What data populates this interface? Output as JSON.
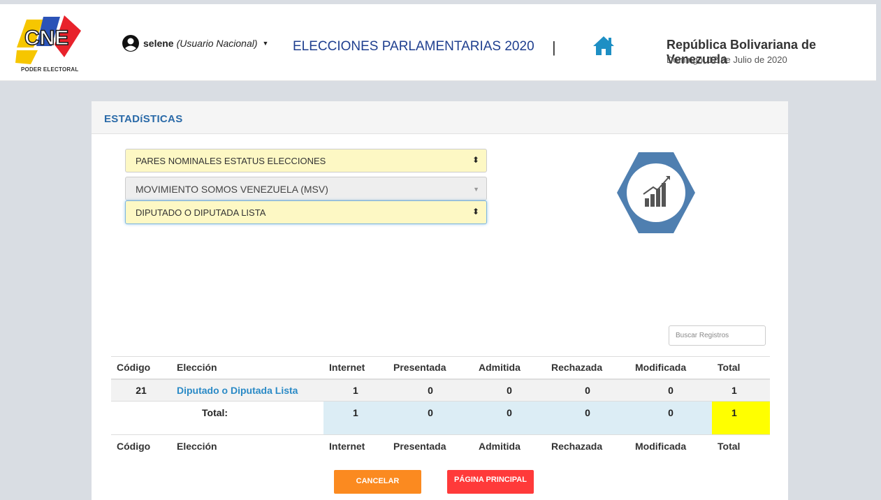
{
  "header": {
    "logo_caption": "PODER ELECTORAL",
    "user_name": "selene",
    "user_role": "(Usuario Nacional)",
    "election_title": "ELECCIONES PARLAMENTARIAS 2020",
    "separator": "|",
    "country": "República Bolivariana de Venezuela",
    "date": "Domingo, 12 de Julio de 2020"
  },
  "panel": {
    "title": "ESTADíSTICAS"
  },
  "filters": {
    "report_type": "PARES NOMINALES ESTATUS ELECCIONES",
    "organization": "MOVIMIENTO SOMOS VENEZUELA (MSV)",
    "election_type": "DIPUTADO O DIPUTADA LISTA"
  },
  "search": {
    "placeholder": "Buscar Registros"
  },
  "table": {
    "headers": [
      "Código",
      "Elección",
      "Internet",
      "Presentada",
      "Admitida",
      "Rechazada",
      "Modificada",
      "Total"
    ],
    "rows": [
      {
        "codigo": "21",
        "eleccion": "Diputado o Diputada Lista",
        "internet": "1",
        "presentada": "0",
        "admitida": "0",
        "rechazada": "0",
        "modificada": "0",
        "total": "1"
      }
    ],
    "totals": {
      "label": "Total:",
      "internet": "1",
      "presentada": "0",
      "admitida": "0",
      "rechazada": "0",
      "modificada": "0",
      "total": "1"
    }
  },
  "buttons": {
    "cancel": "CANCELAR",
    "main_page": "PÁGINA PRINCIPAL"
  },
  "colors": {
    "accent_blue": "#2a6aa8",
    "badge_blue": "#4f7fb0",
    "cancel_orange": "#fb8a20",
    "main_red": "#ff3a3a",
    "total_highlight": "#ffff00"
  },
  "icons": {
    "user": "user-circle-icon",
    "home": "home-icon",
    "stats": "bar-chart-icon"
  }
}
